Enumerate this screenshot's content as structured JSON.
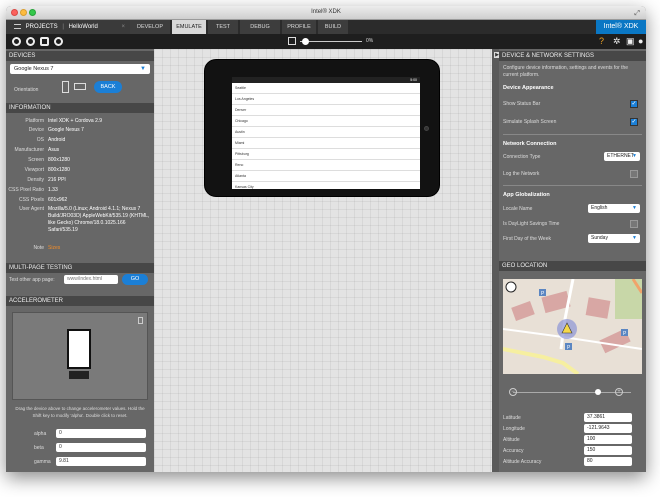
{
  "window": {
    "title": "Intel® XDK"
  },
  "tabbar": {
    "projects_label": "PROJECTS",
    "project_name": "HelloWorld",
    "tabs": [
      {
        "label": "DEVELOP",
        "active": false
      },
      {
        "label": "EMULATE",
        "active": true
      },
      {
        "label": "TEST",
        "active": false
      },
      {
        "label": "DEBUG",
        "active": false
      },
      {
        "label": "PROFILE",
        "active": false
      },
      {
        "label": "BUILD",
        "active": false
      }
    ],
    "brand": "Intel® XDK"
  },
  "toolbar": {
    "zoom": "0%"
  },
  "devices": {
    "header": "DEVICES",
    "selected": "Google Nexus 7",
    "orientation_label": "Orientation",
    "back_label": "BACK"
  },
  "information": {
    "header": "INFORMATION",
    "rows": [
      {
        "label": "Platform",
        "value": "Intel XDK + Cordova 2.9"
      },
      {
        "label": "Device",
        "value": "Google Nexus 7"
      },
      {
        "label": "OS",
        "value": "Android"
      },
      {
        "label": "Manufacturer",
        "value": "Asus"
      },
      {
        "label": "Screen",
        "value": "800x1280"
      },
      {
        "label": "Viewport",
        "value": "800x1280"
      },
      {
        "label": "Density",
        "value": "216 PPI"
      },
      {
        "label": "CSS Pixel Ratio",
        "value": "1.33"
      },
      {
        "label": "CSS Pixels",
        "value": "601x962"
      },
      {
        "label": "User Agent",
        "value": "Mozilla/5.0 (Linux; Android 4.1.1; Nexus 7 Build/JRO03D) AppleWebKit/535.19 (KHTML, like Gecko) Chrome/18.0.1025.166 Safari/535.19"
      },
      {
        "label": "Note",
        "value": "Sizes",
        "accent": true
      }
    ]
  },
  "multipage": {
    "header": "MULTI-PAGE TESTING",
    "label": "Test other app page:",
    "placeholder": "www/index.html",
    "go": "GO"
  },
  "accelerometer": {
    "header": "ACCELEROMETER",
    "help": "Drag the device above to change accelerometer values. Hold the Shift key to modify 'alpha'. Double click to reset.",
    "rows": [
      {
        "label": "alpha",
        "value": "0"
      },
      {
        "label": "beta",
        "value": "0"
      },
      {
        "label": "gamma",
        "value": "9.81"
      }
    ]
  },
  "emulator": {
    "status": "5:00",
    "cities": [
      "Seattle",
      "Los Angeles",
      "Denver",
      "Chicago",
      "Austin",
      "Miami",
      "Pittsburg",
      "Reno",
      "Atlanta",
      "Kansas City"
    ]
  },
  "settings": {
    "header": "DEVICE & NETWORK SETTINGS",
    "intro": "Configure device information, settings and events for the current platform.",
    "appearance_header": "Device Appearance",
    "show_status_bar": "Show Status Bar",
    "simulate_splash": "Simulate Splash Screen",
    "network_header": "Network Connection",
    "connection_label": "Connection Type",
    "connection_value": "ETHERNET",
    "log_network": "Log the Network",
    "glob_header": "App Globalization",
    "locale_label": "Locale Name",
    "locale_value": "English",
    "dst_label": "Is DayLight Savings Time",
    "week_label": "First Day of the Week",
    "week_value": "Sunday"
  },
  "geo": {
    "header": "GEO LOCATION",
    "rows": [
      {
        "label": "Latitude",
        "value": "37.3861"
      },
      {
        "label": "Longitude",
        "value": "-121.9643"
      },
      {
        "label": "Altitude",
        "value": "100"
      },
      {
        "label": "Accuracy",
        "value": "150"
      },
      {
        "label": "Altitude Accuracy",
        "value": "80"
      }
    ]
  },
  "colors": {
    "accent": "#1b7fd6",
    "brand": "#0a77c4",
    "note": "#f28c28"
  }
}
